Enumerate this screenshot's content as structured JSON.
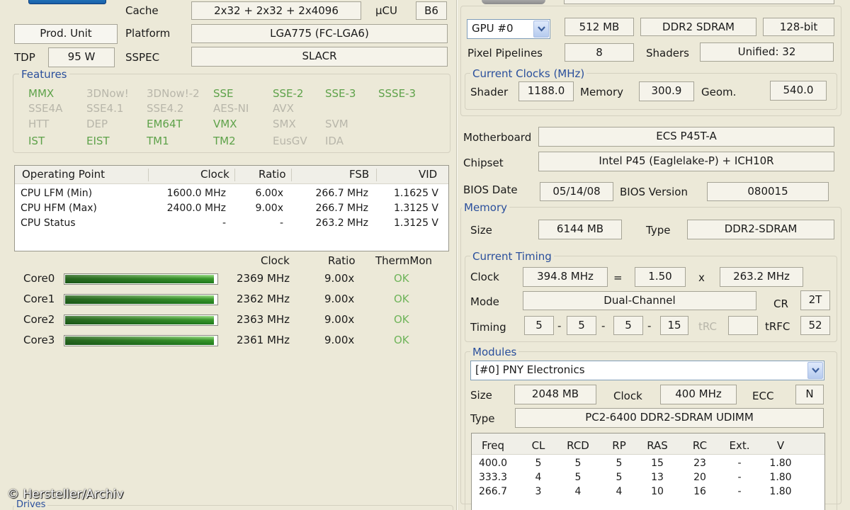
{
  "cpu": {
    "cache_label": "Cache",
    "cache_value": "2x32 + 2x32 + 2x4096",
    "ucu_label": "µCU",
    "ucu_value": "B6",
    "prod_unit_button": "Prod. Unit",
    "platform_label": "Platform",
    "platform_value": "LGA775 (FC-LGA6)",
    "tdp_label": "TDP",
    "tdp_value": "95 W",
    "sspec_label": "SSPEC",
    "sspec_value": "SLACR"
  },
  "features": {
    "title": "Features",
    "items": [
      {
        "label": "MMX",
        "enabled": true
      },
      {
        "label": "3DNow!",
        "enabled": false
      },
      {
        "label": "3DNow!-2",
        "enabled": false
      },
      {
        "label": "SSE",
        "enabled": true
      },
      {
        "label": "SSE-2",
        "enabled": true
      },
      {
        "label": "SSE-3",
        "enabled": true
      },
      {
        "label": "SSSE-3",
        "enabled": true
      },
      {
        "label": "SSE4A",
        "enabled": false
      },
      {
        "label": "SSE4.1",
        "enabled": false
      },
      {
        "label": "SSE4.2",
        "enabled": false
      },
      {
        "label": "AES-NI",
        "enabled": false
      },
      {
        "label": "AVX",
        "enabled": false
      },
      {
        "label": "HTT",
        "enabled": false
      },
      {
        "label": "DEP",
        "enabled": false
      },
      {
        "label": "EM64T",
        "enabled": true
      },
      {
        "label": "VMX",
        "enabled": true
      },
      {
        "label": "SMX",
        "enabled": false
      },
      {
        "label": "SVM",
        "enabled": false
      },
      {
        "label": "IST",
        "enabled": true
      },
      {
        "label": "EIST",
        "enabled": true
      },
      {
        "label": "TM1",
        "enabled": true
      },
      {
        "label": "TM2",
        "enabled": true
      },
      {
        "label": "EusGV",
        "enabled": false
      },
      {
        "label": "IDA",
        "enabled": false
      }
    ]
  },
  "operating_points": {
    "columns": [
      "Operating Point",
      "Clock",
      "Ratio",
      "FSB",
      "VID"
    ],
    "rows": [
      [
        "CPU LFM (Min)",
        "1600.0 MHz",
        "6.00x",
        "266.7 MHz",
        "1.1625 V"
      ],
      [
        "CPU HFM (Max)",
        "2400.0 MHz",
        "9.00x",
        "266.7 MHz",
        "1.3125 V"
      ],
      [
        "CPU Status",
        "-",
        "-",
        "263.2 MHz",
        "1.3125 V"
      ]
    ]
  },
  "cores": {
    "headers": {
      "clock": "Clock",
      "ratio": "Ratio",
      "thermmon": "ThermMon"
    },
    "items": [
      {
        "name": "Core0",
        "clock": "2369 MHz",
        "ratio": "9.00x",
        "therm": "OK",
        "load": 1.0
      },
      {
        "name": "Core1",
        "clock": "2362 MHz",
        "ratio": "9.00x",
        "therm": "OK",
        "load": 1.0
      },
      {
        "name": "Core2",
        "clock": "2363 MHz",
        "ratio": "9.00x",
        "therm": "OK",
        "load": 1.0
      },
      {
        "name": "Core3",
        "clock": "2361 MHz",
        "ratio": "9.00x",
        "therm": "OK",
        "load": 1.0
      }
    ]
  },
  "drives_title": "Drives",
  "gpu": {
    "selector": "GPU #0",
    "memory": "512 MB",
    "memory_type": "DDR2 SDRAM",
    "bus_width": "128-bit",
    "pixel_pipelines_label": "Pixel Pipelines",
    "pixel_pipelines_value": "8",
    "shaders_label": "Shaders",
    "shaders_value": "Unified: 32",
    "clocks_title": "Current Clocks (MHz)",
    "shader_label": "Shader",
    "shader_value": "1188.0",
    "memory_label": "Memory",
    "memory_value": "300.9",
    "geom_label": "Geom.",
    "geom_value": "540.0"
  },
  "board": {
    "motherboard_label": "Motherboard",
    "motherboard_value": "ECS P45T-A",
    "chipset_label": "Chipset",
    "chipset_value": "Intel P45 (Eaglelake-P) + ICH10R",
    "bios_date_label": "BIOS Date",
    "bios_date_value": "05/14/08",
    "bios_version_label": "BIOS Version",
    "bios_version_value": "080015"
  },
  "memory": {
    "title": "Memory",
    "size_label": "Size",
    "size_value": "6144 MB",
    "type_label": "Type",
    "type_value": "DDR2-SDRAM",
    "timing_title": "Current Timing",
    "clock_label": "Clock",
    "clock_value": "394.8 MHz",
    "eq": "=",
    "multiplier": "1.50",
    "times": "x",
    "fsb_value": "263.2 MHz",
    "mode_label": "Mode",
    "mode_value": "Dual-Channel",
    "cr_label": "CR",
    "cr_value": "2T",
    "timing_label": "Timing",
    "t1": "5",
    "t2": "5",
    "t3": "5",
    "t4": "15",
    "dash": "-",
    "trc_label": "tRC",
    "trc_value": "",
    "trfc_label": "tRFC",
    "trfc_value": "52"
  },
  "modules": {
    "title": "Modules",
    "selected": "[#0] PNY Electronics",
    "size_label": "Size",
    "size_value": "2048 MB",
    "clock_label": "Clock",
    "clock_value": "400 MHz",
    "ecc_label": "ECC",
    "ecc_value": "N",
    "type_label": "Type",
    "type_value": "PC2-6400 DDR2-SDRAM UDIMM",
    "spd_columns": [
      "Freq",
      "CL",
      "RCD",
      "RP",
      "RAS",
      "RC",
      "Ext.",
      "V"
    ],
    "spd_rows": [
      [
        "400.0",
        "5",
        "5",
        "5",
        "15",
        "23",
        "-",
        "1.80"
      ],
      [
        "333.3",
        "4",
        "5",
        "5",
        "13",
        "20",
        "-",
        "1.80"
      ],
      [
        "266.7",
        "3",
        "4",
        "4",
        "10",
        "16",
        "-",
        "1.80"
      ]
    ]
  },
  "watermark": "© Hersteller/Archiv",
  "colors": {
    "background": "#ece9d8",
    "feature_on": "#5ea24a",
    "feature_off": "#b8b6aa",
    "group_title": "#2a4f9c",
    "status_ok": "#6fb45a"
  }
}
